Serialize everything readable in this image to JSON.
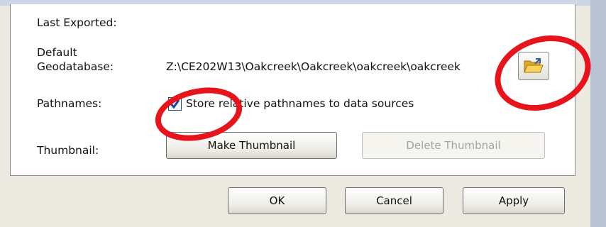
{
  "properties": {
    "last_exported_label": "Last Exported:",
    "default_gdb_label_line1": "Default",
    "default_gdb_label_line2": "Geodatabase:",
    "default_gdb_value": "Z:\\CE202W13\\Oakcreek\\Oakcreek\\oakcreek\\oakcreek",
    "pathnames_label": "Pathnames:",
    "relative_paths_label": "Store relative pathnames to data sources",
    "relative_paths_checked": true,
    "thumbnail_label": "Thumbnail:",
    "make_thumbnail_label": "Make Thumbnail",
    "delete_thumbnail_label": "Delete Thumbnail"
  },
  "footer": {
    "ok_label": "OK",
    "cancel_label": "Cancel",
    "apply_label": "Apply"
  },
  "icons": {
    "browse_folder": "open-folder-icon",
    "checkbox_mark": "checkmark-icon"
  },
  "colors": {
    "annotation_red": "#e8141c",
    "checkmark_blue": "#1f3fa8",
    "folder_yellow": "#f2c43d",
    "dialog_background": "#ebe9e0"
  }
}
